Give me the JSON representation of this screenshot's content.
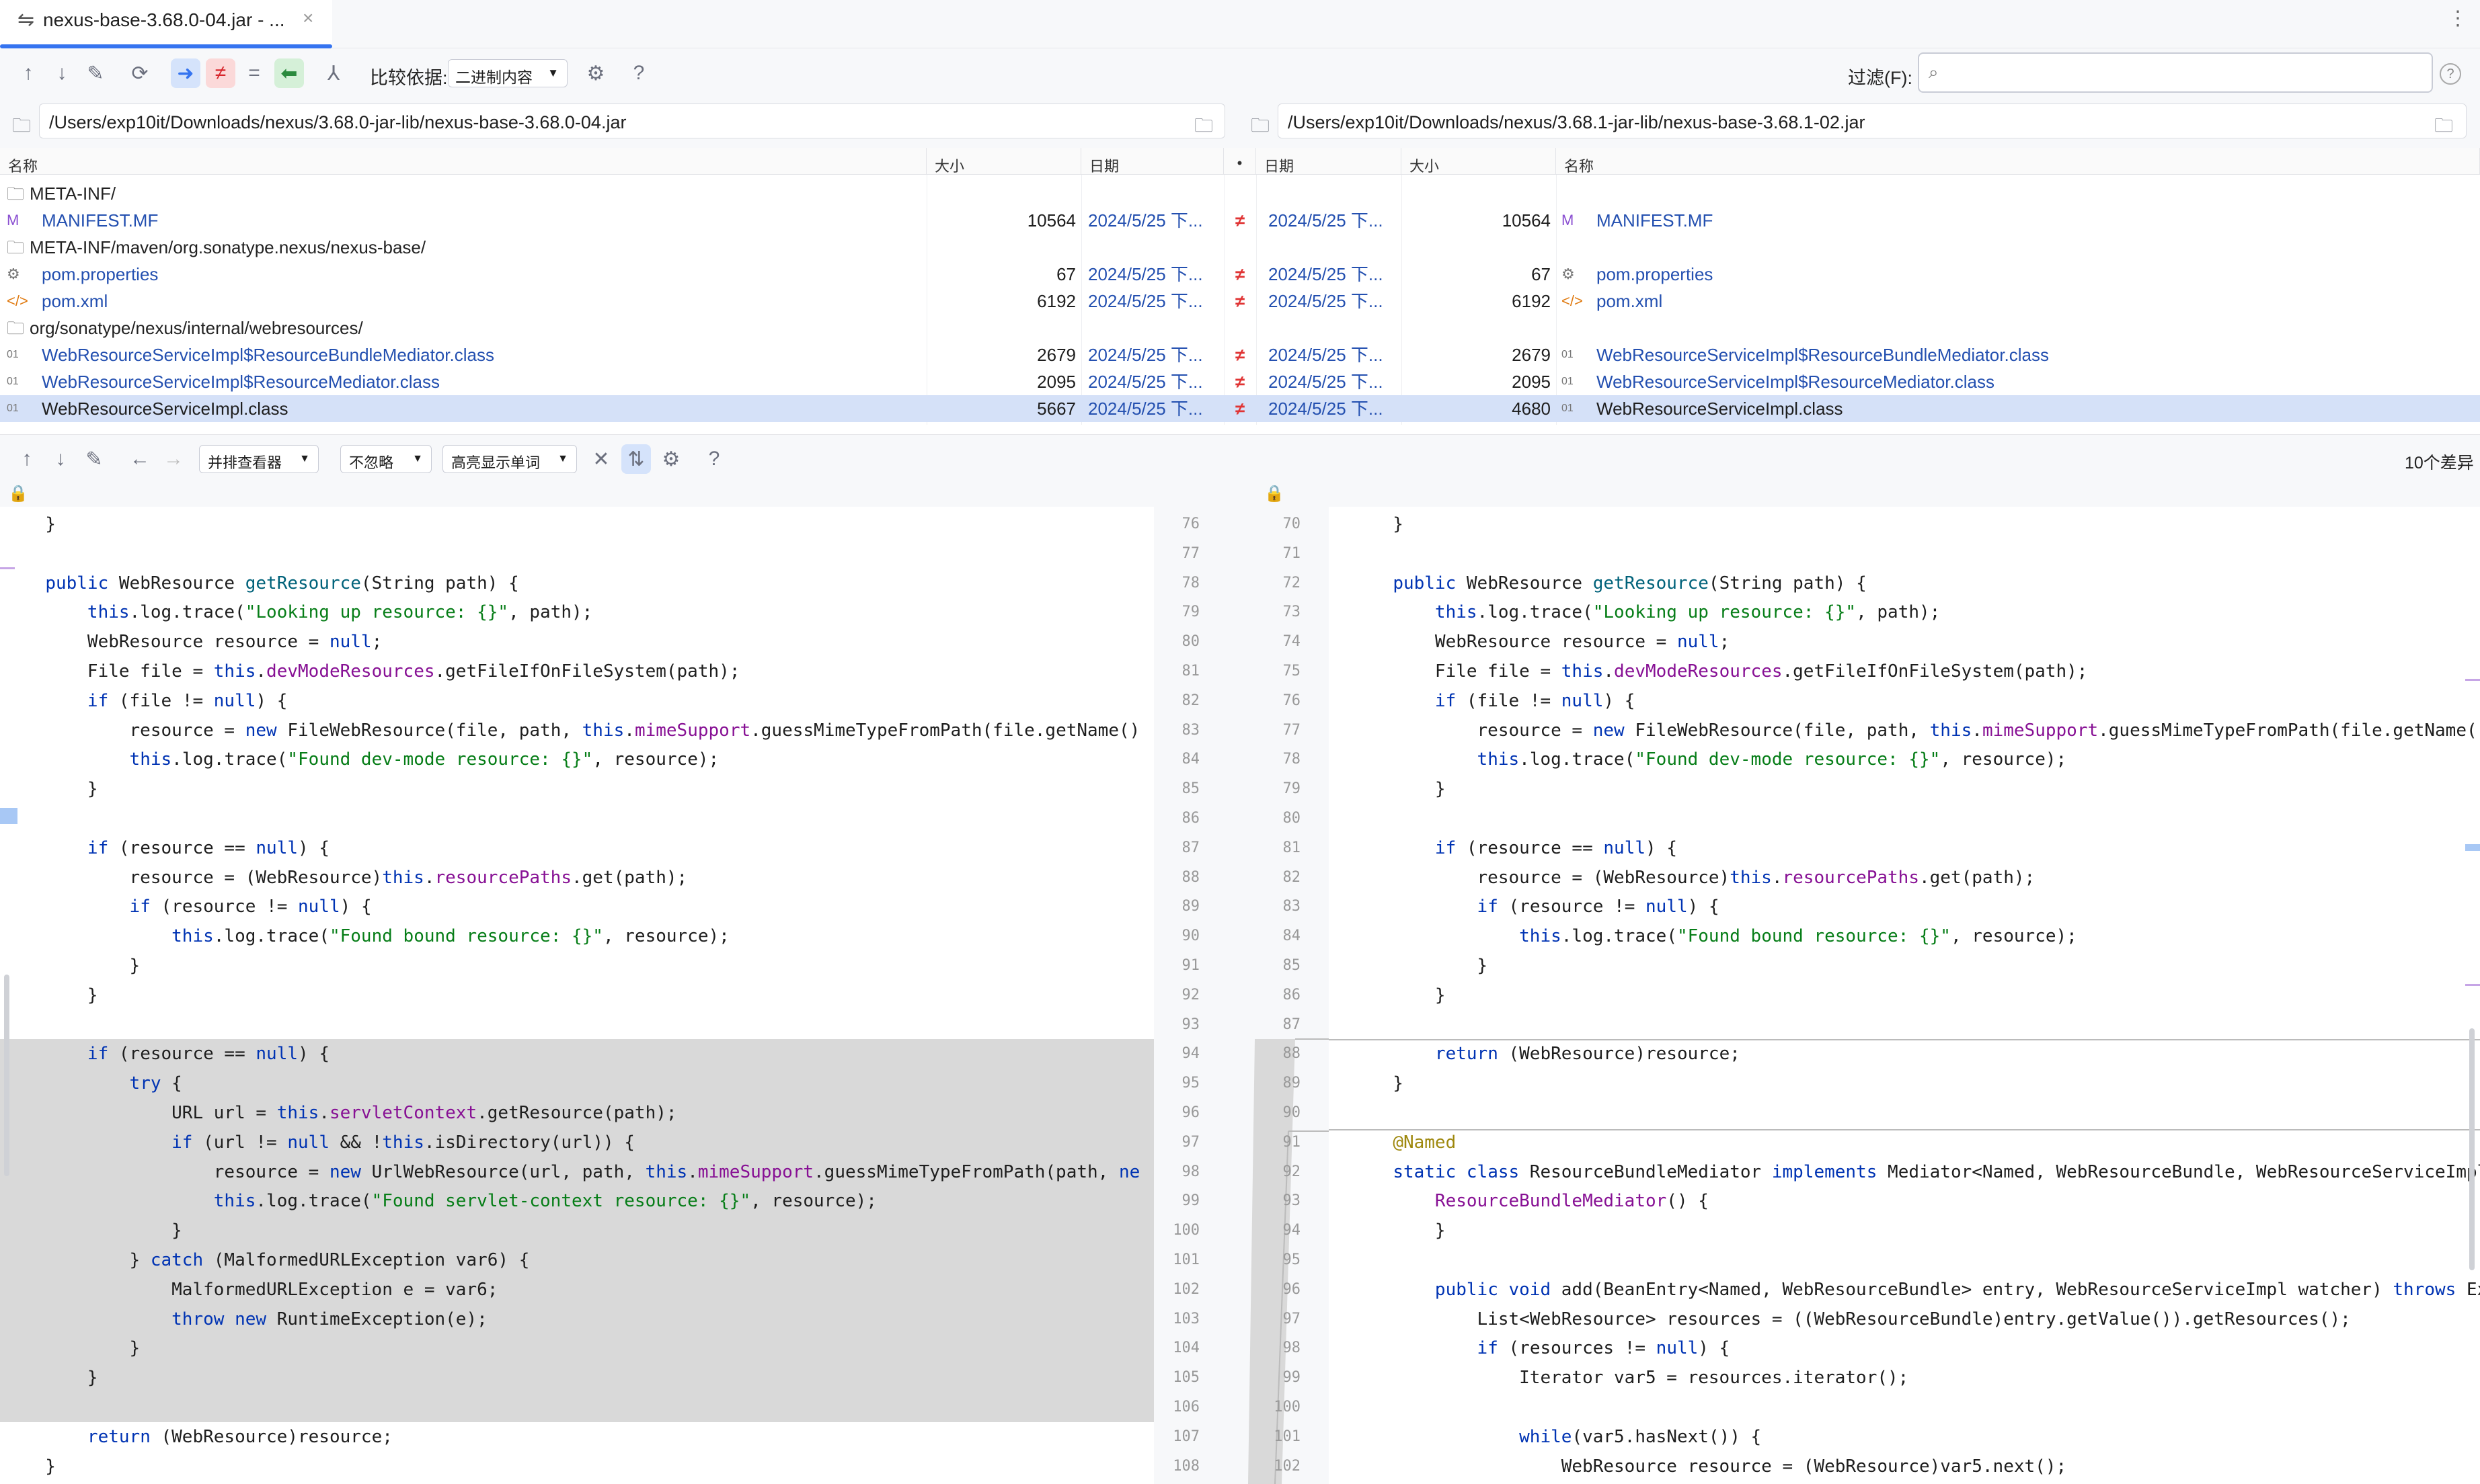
{
  "tab": {
    "title": "nexus-base-3.68.0-04.jar - ...",
    "icon": "diff-icon",
    "close": "×"
  },
  "toolbar1": {
    "compare_label": "比较依据:",
    "compare_value": "二进制内容",
    "filter_label": "过滤(F):",
    "filter_placeholder": ""
  },
  "paths": {
    "left": "/Users/exp10it/Downloads/nexus/3.68.0-jar-lib/nexus-base-3.68.0-04.jar",
    "right": "/Users/exp10it/Downloads/nexus/3.68.1-jar-lib/nexus-base-3.68.1-02.jar"
  },
  "columns": {
    "name": "名称",
    "size": "大小",
    "date": "日期",
    "dot": "•",
    "date_r": "日期",
    "size_r": "大小",
    "name_r": "名称"
  },
  "rows": [
    {
      "type": "dir",
      "name": "META-INF/"
    },
    {
      "type": "file",
      "icon": "M",
      "name": "MANIFEST.MF",
      "lsize": "10564",
      "ldate": "2024/5/25 下...",
      "diff": "≠",
      "rdate": "2024/5/25 下...",
      "rsize": "10564"
    },
    {
      "type": "dir",
      "name": "META-INF/maven/org.sonatype.nexus/nexus-base/"
    },
    {
      "type": "file",
      "icon": "⚙",
      "name": "pom.properties",
      "lsize": "67",
      "ldate": "2024/5/25 下...",
      "diff": "≠",
      "rdate": "2024/5/25 下...",
      "rsize": "67"
    },
    {
      "type": "file",
      "icon": "</>",
      "name": "pom.xml",
      "lsize": "6192",
      "ldate": "2024/5/25 下...",
      "diff": "≠",
      "rdate": "2024/5/25 下...",
      "rsize": "6192"
    },
    {
      "type": "dir",
      "name": "org/sonatype/nexus/internal/webresources/"
    },
    {
      "type": "file",
      "icon": "01",
      "name": "WebResourceServiceImpl$ResourceBundleMediator.class",
      "lsize": "2679",
      "ldate": "2024/5/25 下...",
      "diff": "≠",
      "rdate": "2024/5/25 下...",
      "rsize": "2679"
    },
    {
      "type": "file",
      "icon": "01",
      "name": "WebResourceServiceImpl$ResourceMediator.class",
      "lsize": "2095",
      "ldate": "2024/5/25 下...",
      "diff": "≠",
      "rdate": "2024/5/25 下...",
      "rsize": "2095"
    },
    {
      "type": "file",
      "icon": "01",
      "name": "WebResourceServiceImpl.class",
      "lsize": "5667",
      "ldate": "2024/5/25 下...",
      "diff": "≠",
      "rdate": "2024/5/25 下...",
      "rsize": "4680",
      "selected": true
    }
  ],
  "toolbar2": {
    "viewer": "并排查看器",
    "ignore": "不忽略",
    "highlight": "高亮显示单词",
    "diff_count": "10个差异"
  },
  "left_code": [
    {
      "ln": "76",
      "t": "  }"
    },
    {
      "ln": "77",
      "t": ""
    },
    {
      "ln": "78",
      "t": "  <kw>public</kw> WebResource <fn>getResource</fn>(String path) {"
    },
    {
      "ln": "79",
      "t": "      <kw>this</kw>.log.trace(<str>\"Looking up resource: {}\"</str>, path);"
    },
    {
      "ln": "80",
      "t": "      WebResource resource = <kw>null</kw>;"
    },
    {
      "ln": "81",
      "t": "      File file = <kw>this</kw>.<fld>devModeResources</fld>.getFileIfOnFileSystem(path);"
    },
    {
      "ln": "82",
      "t": "      <kw>if</kw> (file != <kw>null</kw>) {"
    },
    {
      "ln": "83",
      "t": "          resource = <kw>new</kw> FileWebResource(file, path, <kw>this</kw>.<fld>mimeSupport</fld>.guessMimeTypeFromPath(file.getName()"
    },
    {
      "ln": "84",
      "t": "          <kw>this</kw>.log.trace(<str>\"Found dev-mode resource: {}\"</str>, resource);"
    },
    {
      "ln": "85",
      "t": "      }"
    },
    {
      "ln": "86",
      "t": ""
    },
    {
      "ln": "87",
      "t": "      <kw>if</kw> (resource == <kw>null</kw>) {"
    },
    {
      "ln": "88",
      "t": "          resource = (WebResource)<kw>this</kw>.<fld>resourcePaths</fld>.get(path);"
    },
    {
      "ln": "89",
      "t": "          <kw>if</kw> (resource != <kw>null</kw>) {"
    },
    {
      "ln": "90",
      "t": "              <kw>this</kw>.log.trace(<str>\"Found bound resource: {}\"</str>, resource);"
    },
    {
      "ln": "91",
      "t": "          }"
    },
    {
      "ln": "92",
      "t": "      }"
    },
    {
      "ln": "93",
      "t": ""
    },
    {
      "ln": "94",
      "t": "      <kw>if</kw> (resource == <kw>null</kw>) {",
      "chg": true
    },
    {
      "ln": "95",
      "t": "          <kw>try</kw> {",
      "chg": true
    },
    {
      "ln": "96",
      "t": "              URL url = <kw>this</kw>.<fld>servletContext</fld>.getResource(path);",
      "chg": true
    },
    {
      "ln": "97",
      "t": "              <kw>if</kw> (url != <kw>null</kw> && !<kw>this</kw>.isDirectory(url)) {",
      "chg": true
    },
    {
      "ln": "98",
      "t": "                  resource = <kw>new</kw> UrlWebResource(url, path, <kw>this</kw>.<fld>mimeSupport</fld>.guessMimeTypeFromPath(path, <kw>ne</kw>",
      "chg": true
    },
    {
      "ln": "99",
      "t": "                  <kw>this</kw>.log.trace(<str>\"Found servlet-context resource: {}\"</str>, resource);",
      "chg": true
    },
    {
      "ln": "100",
      "t": "              }",
      "chg": true
    },
    {
      "ln": "101",
      "t": "          } <kw>catch</kw> (MalformedURLException var6) {",
      "chg": true
    },
    {
      "ln": "102",
      "t": "              MalformedURLException e = var6;",
      "chg": true
    },
    {
      "ln": "103",
      "t": "              <kw>throw new</kw> RuntimeException(e);",
      "chg": true
    },
    {
      "ln": "104",
      "t": "          }",
      "chg": true
    },
    {
      "ln": "105",
      "t": "      }",
      "chg": true
    },
    {
      "ln": "106",
      "t": "",
      "chg": true
    },
    {
      "ln": "107",
      "t": "      <kw>return</kw> (WebResource)resource;"
    },
    {
      "ln": "108",
      "t": "  }"
    }
  ],
  "right_code": [
    {
      "ln": "70",
      "t": "  }"
    },
    {
      "ln": "71",
      "t": ""
    },
    {
      "ln": "72",
      "t": "  <kw>public</kw> WebResource <fn>getResource</fn>(String path) {"
    },
    {
      "ln": "73",
      "t": "      <kw>this</kw>.log.trace(<str>\"Looking up resource: {}\"</str>, path);"
    },
    {
      "ln": "74",
      "t": "      WebResource resource = <kw>null</kw>;"
    },
    {
      "ln": "75",
      "t": "      File file = <kw>this</kw>.<fld>devModeResources</fld>.getFileIfOnFileSystem(path);"
    },
    {
      "ln": "76",
      "t": "      <kw>if</kw> (file != <kw>null</kw>) {"
    },
    {
      "ln": "77",
      "t": "          resource = <kw>new</kw> FileWebResource(file, path, <kw>this</kw>.<fld>mimeSupport</fld>.guessMimeTypeFromPath(file.getName(),"
    },
    {
      "ln": "78",
      "t": "          <kw>this</kw>.log.trace(<str>\"Found dev-mode resource: {}\"</str>, resource);"
    },
    {
      "ln": "79",
      "t": "      }"
    },
    {
      "ln": "80",
      "t": ""
    },
    {
      "ln": "81",
      "t": "      <kw>if</kw> (resource == <kw>null</kw>) {"
    },
    {
      "ln": "82",
      "t": "          resource = (WebResource)<kw>this</kw>.<fld>resourcePaths</fld>.get(path);"
    },
    {
      "ln": "83",
      "t": "          <kw>if</kw> (resource != <kw>null</kw>) {"
    },
    {
      "ln": "84",
      "t": "              <kw>this</kw>.log.trace(<str>\"Found bound resource: {}\"</str>, resource);"
    },
    {
      "ln": "85",
      "t": "          }"
    },
    {
      "ln": "86",
      "t": "      }"
    },
    {
      "ln": "87",
      "t": ""
    },
    {
      "ln": "88",
      "t": "      <kw>return</kw> (WebResource)resource;"
    },
    {
      "ln": "89",
      "t": "  }"
    },
    {
      "ln": "90",
      "t": ""
    },
    {
      "ln": "91",
      "t": "  <ann>@Named</ann>"
    },
    {
      "ln": "92",
      "t": "  <kw>static class</kw> ResourceBundleMediator <kw>implements</kw> Mediator&lt;Named, WebResourceBundle, WebResourceServiceImpl&gt;"
    },
    {
      "ln": "93",
      "t": "      <fld>ResourceBundleMediator</fld>() {"
    },
    {
      "ln": "94",
      "t": "      }"
    },
    {
      "ln": "95",
      "t": ""
    },
    {
      "ln": "96",
      "t": "      <kw>public void</kw> add(BeanEntry&lt;Named, WebResourceBundle&gt; entry, WebResourceServiceImpl watcher) <kw>throws</kw> Exce"
    },
    {
      "ln": "97",
      "t": "          List&lt;WebResource&gt; resources = ((WebResourceBundle)entry.getValue()).getResources();"
    },
    {
      "ln": "98",
      "t": "          <kw>if</kw> (resources != <kw>null</kw>) {"
    },
    {
      "ln": "99",
      "t": "              Iterator var5 = resources.iterator();"
    },
    {
      "ln": "100",
      "t": ""
    },
    {
      "ln": "101",
      "t": "              <kw>while</kw>(var5.hasNext()) {"
    },
    {
      "ln": "102",
      "t": "                  WebResource resource = (WebResource)var5.next();"
    }
  ]
}
